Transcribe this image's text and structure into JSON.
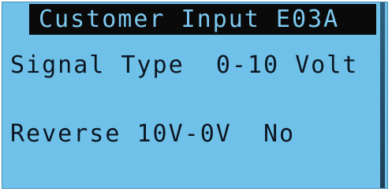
{
  "screen": {
    "title": "Customer Input E03A",
    "rows": [
      {
        "label": "Signal Type",
        "value": "0-10 Volt"
      },
      {
        "label": "Reverse 10V-0V",
        "value": "No"
      }
    ]
  },
  "colors": {
    "lcd_background": "#6fc1ea",
    "title_background": "#0a0a0a",
    "title_text": "#7cc8ef",
    "text": "#0d1620"
  }
}
